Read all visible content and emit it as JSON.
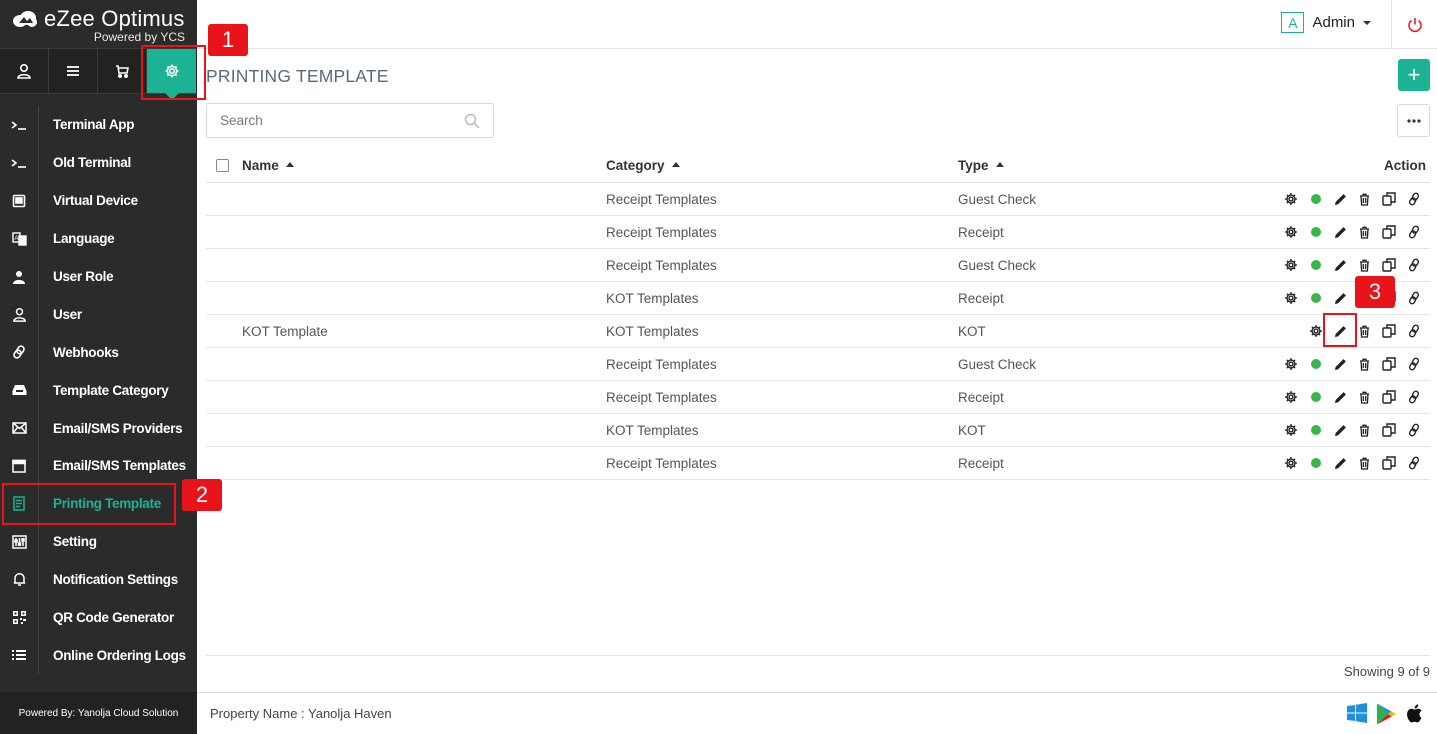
{
  "brand": {
    "name": "eZee Optimus",
    "sub": "Powered by YCS"
  },
  "tabs": [
    {
      "icon": "user-icon"
    },
    {
      "icon": "menu-icon"
    },
    {
      "icon": "cart-icon"
    },
    {
      "icon": "gear-icon",
      "active": true
    }
  ],
  "sidebar": {
    "items": [
      {
        "label": "Terminal App",
        "icon": "terminal-icon"
      },
      {
        "label": "Old Terminal",
        "icon": "terminal-icon"
      },
      {
        "label": "Virtual Device",
        "icon": "device-icon"
      },
      {
        "label": "Language",
        "icon": "language-icon"
      },
      {
        "label": "User Role",
        "icon": "user-role-icon"
      },
      {
        "label": "User",
        "icon": "user-icon"
      },
      {
        "label": "Webhooks",
        "icon": "link-icon"
      },
      {
        "label": "Template Category",
        "icon": "inbox-icon"
      },
      {
        "label": "Email/SMS Providers",
        "icon": "envelope-icon"
      },
      {
        "label": "Email/SMS Templates",
        "icon": "calendar-icon"
      },
      {
        "label": "Printing Template",
        "icon": "document-icon",
        "active": true
      },
      {
        "label": "Setting",
        "icon": "sliders-icon"
      },
      {
        "label": "Notification Settings",
        "icon": "bell-icon"
      },
      {
        "label": "QR Code Generator",
        "icon": "qr-code-icon"
      },
      {
        "label": "Online Ordering Logs",
        "icon": "list-icon"
      }
    ],
    "footer": "Powered By: Yanolja Cloud Solution"
  },
  "header": {
    "avatar_letter": "A",
    "user_name": "Admin"
  },
  "page": {
    "title": "PRINTING TEMPLATE",
    "add_label": "+"
  },
  "search": {
    "placeholder": "Search",
    "value": ""
  },
  "table": {
    "columns": {
      "name": "Name",
      "category": "Category",
      "type": "Type",
      "action": "Action"
    },
    "rows": [
      {
        "name": "",
        "category": "Receipt Templates",
        "type": "Guest Check",
        "active": true
      },
      {
        "name": "",
        "category": "Receipt Templates",
        "type": "Receipt",
        "active": true
      },
      {
        "name": "",
        "category": "Receipt Templates",
        "type": "Guest Check",
        "active": true
      },
      {
        "name": "",
        "category": "KOT Templates",
        "type": "Receipt",
        "active": true
      },
      {
        "name": "KOT Template",
        "category": "KOT Templates",
        "type": "KOT",
        "active": false
      },
      {
        "name": "",
        "category": "Receipt Templates",
        "type": "Guest Check",
        "active": true
      },
      {
        "name": "",
        "category": "Receipt Templates",
        "type": "Receipt",
        "active": true
      },
      {
        "name": "",
        "category": "KOT Templates",
        "type": "KOT",
        "active": true
      },
      {
        "name": "",
        "category": "Receipt Templates",
        "type": "Receipt",
        "active": true
      }
    ],
    "showing": "Showing 9 of 9"
  },
  "footer": {
    "property": "Property Name : Yanolja Haven"
  },
  "callouts": [
    "1",
    "2",
    "3"
  ],
  "colors": {
    "accent": "#1bb394",
    "sidebar": "#2b2b2b",
    "callout": "#e8141a",
    "status_active": "#3ab54a"
  }
}
